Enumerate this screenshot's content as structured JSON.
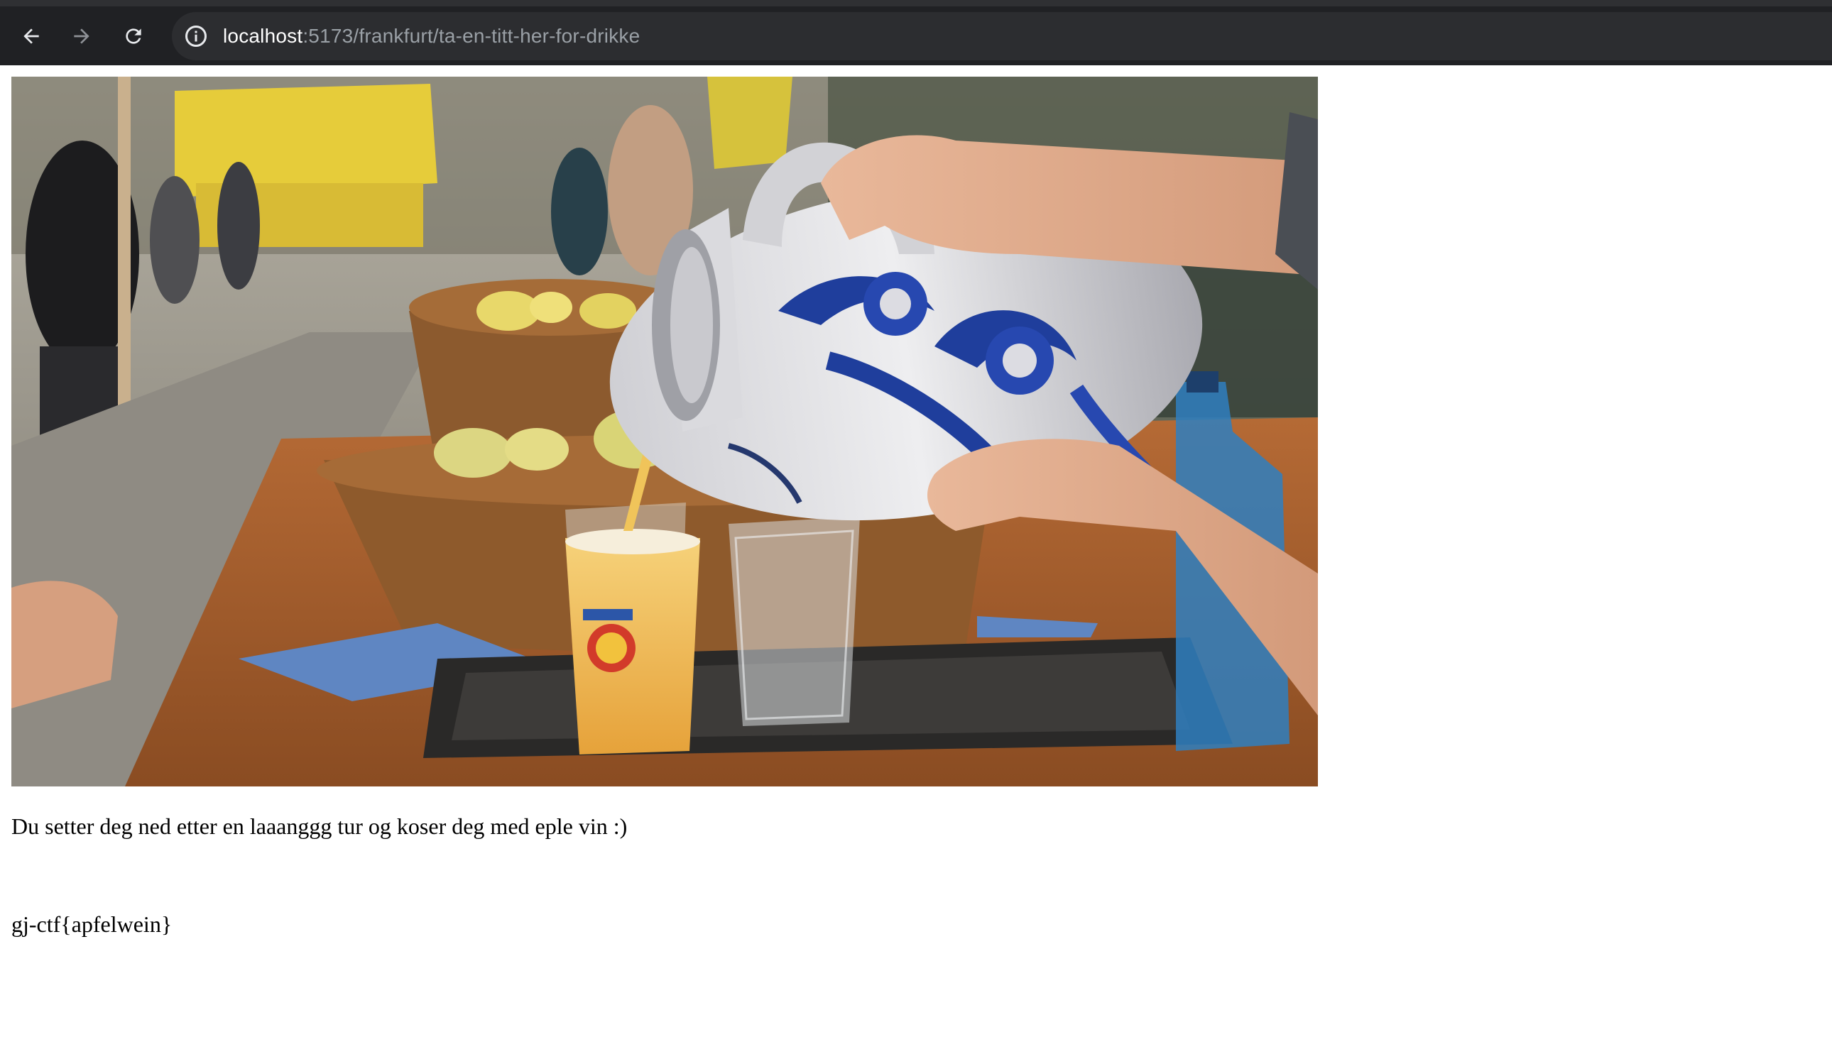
{
  "browser": {
    "url_host": "localhost",
    "url_rest": ":5173/frankfurt/ta-en-titt-her-for-drikke",
    "icons": {
      "back": "arrow-left-icon",
      "forward": "arrow-right-icon",
      "reload": "reload-icon",
      "site_info": "info-icon"
    }
  },
  "page": {
    "description": "Du setter deg ned etter en laaanggg tur og koser deg med eple vin :)",
    "flag": "gj-ctf{apfelwein}"
  },
  "colors": {
    "toolbar": "#202124",
    "omnibox": "#2c2d30",
    "url_host": "#ffffff",
    "url_rest": "#9aa0a6"
  }
}
